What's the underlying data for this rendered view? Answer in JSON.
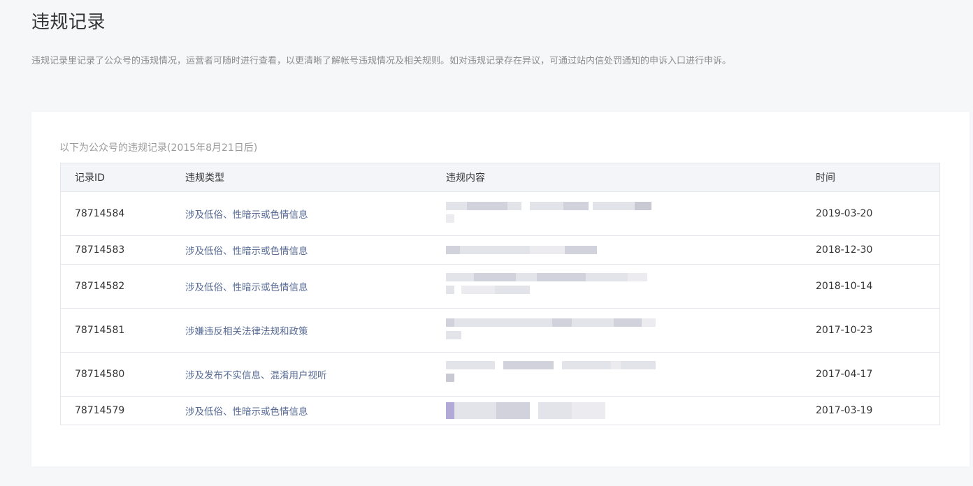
{
  "page": {
    "title": "违规记录",
    "description": "违规记录里记录了公众号的违规情况，运营者可随时进行查看，以更清晰了解帐号违规情况及相关规则。如对违规记录存在异议，可通过站内信处罚通知的申诉入口进行申诉。"
  },
  "table": {
    "caption": "以下为公众号的违规记录(2015年8月21日后)",
    "headers": {
      "id": "记录ID",
      "type": "违规类型",
      "content": "违规内容",
      "time": "时间"
    },
    "rows": [
      {
        "id": "78714584",
        "type": "涉及低俗、性暗示或色情信息",
        "time": "2019-03-20"
      },
      {
        "id": "78714583",
        "type": "涉及低俗、性暗示或色情信息",
        "time": "2018-12-30"
      },
      {
        "id": "78714582",
        "type": "涉及低俗、性暗示或色情信息",
        "time": "2018-10-14"
      },
      {
        "id": "78714581",
        "type": "涉嫌违反相关法律法规和政策",
        "time": "2017-10-23"
      },
      {
        "id": "78714580",
        "type": "涉及发布不实信息、混淆用户视听",
        "time": "2017-04-17"
      },
      {
        "id": "78714579",
        "type": "涉及低俗、性暗示或色情信息",
        "time": "2017-03-19"
      }
    ]
  }
}
